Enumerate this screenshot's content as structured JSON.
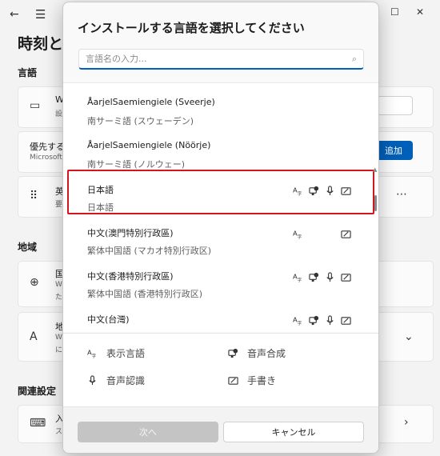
{
  "background": {
    "page_title": "時刻と",
    "section_language": "言語",
    "section_region": "地域",
    "section_related": "関連設定",
    "item1_main": "W",
    "item1_sub": "設",
    "item2_main": "優先する",
    "item2_sub": "Microsoft",
    "add_button": "追加",
    "item3_main": "英",
    "item3_sub": "要",
    "item4_main": "国",
    "item4_sub1": "W",
    "item4_sub2": "た",
    "item5_main": "地",
    "item5_sub1": "W",
    "item5_sub2": "に",
    "item6_main": "入",
    "item6_sub": "ス"
  },
  "dialog": {
    "title": "インストールする言語を選択してください",
    "search": {
      "placeholder": "言語名の入力...",
      "value": ""
    },
    "languages": [
      {
        "name": "ÅarjelSaemiengiele (Sveerje)",
        "native": "南サーミ語 (スウェーデン)",
        "caps": []
      },
      {
        "name": "ÅarjelSaemiengiele (Nöörje)",
        "native": "南サーミ語 (ノルウェー)",
        "caps": []
      },
      {
        "name": "日本語",
        "native": "日本語",
        "caps": [
          "display-language",
          "text-to-speech",
          "speech-recognition",
          "handwriting"
        ]
      },
      {
        "name": "中文(澳門特別行政區)",
        "native": "繁体中国語 (マカオ特別行政区)",
        "caps": [
          "display-language",
          "handwriting"
        ]
      },
      {
        "name": "中文(香港特別行政區)",
        "native": "繁体中国語 (香港特別行政区)",
        "caps": [
          "display-language",
          "text-to-speech",
          "speech-recognition",
          "handwriting"
        ]
      },
      {
        "name": "中文(台灣)",
        "native": "繁体中国語 (台湾)",
        "caps": [
          "display-language",
          "text-to-speech",
          "speech-recognition",
          "handwriting"
        ]
      }
    ],
    "legend": {
      "display_language": "表示言語",
      "text_to_speech": "音声合成",
      "speech_recognition": "音声認識",
      "handwriting": "手書き"
    },
    "buttons": {
      "next": "次へ",
      "cancel": "キャンセル"
    }
  },
  "colors": {
    "accent": "#005fb8",
    "highlight_border": "#d6141e"
  }
}
